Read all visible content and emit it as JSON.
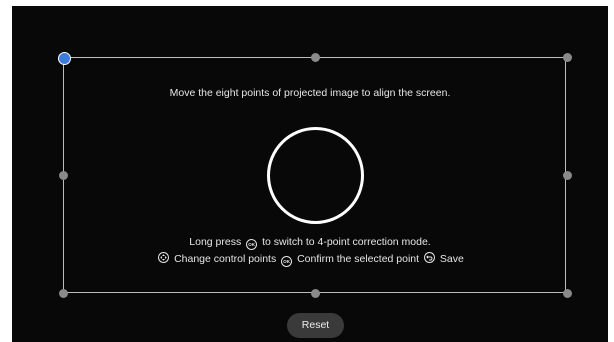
{
  "instructions": {
    "top": "Move the eight points of projected image to align the screen.",
    "line1_before": "Long press",
    "line1_icon": "OK",
    "line1_after": "to switch to 4-point correction mode.",
    "line2_part1": "Change control points",
    "line2_icon_ok": "OK",
    "line2_part2": "Confirm the selected point",
    "line2_part3": "Save"
  },
  "buttons": {
    "reset": "Reset"
  },
  "control_points": {
    "selected": "top-left",
    "selected_color": "#3c7be0",
    "idle_color": "#8a8a8a"
  },
  "icons": [
    "dpad-icon",
    "ok-button-icon",
    "back-icon"
  ]
}
